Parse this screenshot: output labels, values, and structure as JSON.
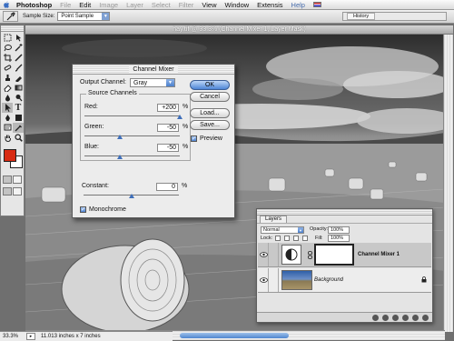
{
  "menubar": {
    "app_name": "Photoshop",
    "items": [
      "File",
      "Edit",
      "Image",
      "Layer",
      "Select",
      "Filter",
      "View",
      "Window",
      "Extensis",
      "Help"
    ],
    "dim_items": [
      "Image",
      "Layer",
      "Select",
      "Filter"
    ]
  },
  "options_bar": {
    "sample_size_label": "Sample Size:",
    "sample_size_value": "Point Sample",
    "palette_well_tab": "History"
  },
  "document": {
    "title": "hay.tif @ 33.3% (Channel Mixer 1, Layer Mask)",
    "zoom": "33.3%",
    "doc_size": "11.013 inches x 7 inches"
  },
  "channel_mixer": {
    "title": "Channel Mixer",
    "output_channel_label": "Output Channel:",
    "output_channel_value": "Gray",
    "source_channels_label": "Source Channels",
    "channels": [
      {
        "label": "Red:",
        "value": "+200",
        "percent": 200
      },
      {
        "label": "Green:",
        "value": "-50",
        "percent": -50
      },
      {
        "label": "Blue:",
        "value": "-50",
        "percent": -50
      }
    ],
    "constant_label": "Constant:",
    "constant_value": "0",
    "constant_percent": 0,
    "pct_sign": "%",
    "monochrome_label": "Monochrome",
    "monochrome_checked": true,
    "buttons": {
      "ok": "OK",
      "cancel": "Cancel",
      "load": "Load...",
      "save": "Save..."
    },
    "preview_label": "Preview",
    "preview_checked": true
  },
  "layers_palette": {
    "tab": "Layers",
    "blend_mode": "Normal",
    "opacity_label": "Opacity:",
    "opacity_value": "100%",
    "lock_label": "Lock:",
    "fill_label": "Fill:",
    "fill_value": "100%",
    "layers": [
      {
        "name": "Channel Mixer 1",
        "selected": true
      },
      {
        "name": "Background",
        "selected": false
      }
    ]
  },
  "colors": {
    "foreground": "#d82a12",
    "background": "#ffffff",
    "accent": "#4e86d6"
  }
}
